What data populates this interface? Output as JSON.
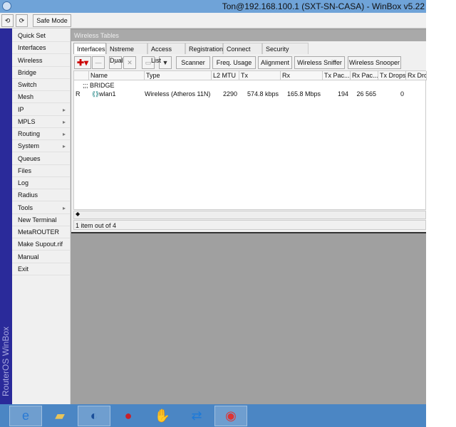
{
  "window_title": "Ton@192.168.100.1 (SXT-SN-CASA) - WinBox v5.22",
  "toolbar": {
    "undo": "⟲",
    "redo": "⟳",
    "safe_mode": "Safe Mode"
  },
  "brand": "RouterOS WinBox",
  "menu": [
    {
      "label": "Quick Set"
    },
    {
      "label": "Interfaces"
    },
    {
      "label": "Wireless"
    },
    {
      "label": "Bridge"
    },
    {
      "label": "Switch"
    },
    {
      "label": "Mesh"
    },
    {
      "label": "IP",
      "sub": true
    },
    {
      "label": "MPLS",
      "sub": true
    },
    {
      "label": "Routing",
      "sub": true
    },
    {
      "label": "System",
      "sub": true
    },
    {
      "label": "Queues"
    },
    {
      "label": "Files"
    },
    {
      "label": "Log"
    },
    {
      "label": "Radius"
    },
    {
      "label": "Tools",
      "sub": true
    },
    {
      "label": "New Terminal"
    },
    {
      "label": "MetaROUTER"
    },
    {
      "label": "Make Supout.rif"
    },
    {
      "label": "Manual"
    },
    {
      "label": "Exit"
    }
  ],
  "wireless": {
    "title": "Wireless Tables",
    "tabs": [
      "Interfaces",
      "Nstreme Dual",
      "Access List",
      "Registration",
      "Connect List",
      "Security Profiles"
    ],
    "buttons": [
      "Scanner",
      "Freq. Usage",
      "Alignment",
      "Wireless Sniffer",
      "Wireless Snooper"
    ],
    "columns": [
      "",
      "Name",
      "Type",
      "L2 MTU",
      "Tx",
      "Rx",
      "Tx Pac...",
      "Rx Pac...",
      "Tx Drops",
      "Rx Dro"
    ],
    "group": ";;; BRIDGE",
    "rows": [
      {
        "flag": "R",
        "name": "wlan1",
        "type": "Wireless (Atheros 11N)",
        "l2mtu": "2290",
        "tx": "574.8 kbps",
        "rx": "165.8 Mbps",
        "tx_packets": "194",
        "rx_packets": "26 565",
        "tx_drops": "0",
        "rx_drops": ""
      }
    ],
    "status": "1 item out of 4"
  },
  "taskbar": [
    "internet-explorer",
    "file-explorer",
    "winbox",
    "app-red",
    "app-glove",
    "teamviewer",
    "chrome"
  ]
}
